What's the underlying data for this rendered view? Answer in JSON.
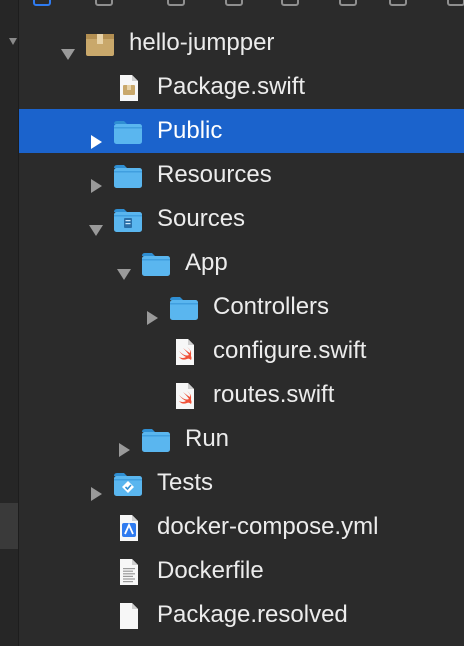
{
  "tree": [
    {
      "label": "hello-jumpper",
      "depth": 0,
      "disclosure": "open",
      "icon": "package-folder-icon",
      "selected": false
    },
    {
      "label": "Package.swift",
      "depth": 1,
      "disclosure": "none",
      "icon": "swift-package-file-icon",
      "selected": false
    },
    {
      "label": "Public",
      "depth": 1,
      "disclosure": "closed",
      "icon": "folder-icon",
      "selected": true
    },
    {
      "label": "Resources",
      "depth": 1,
      "disclosure": "closed",
      "icon": "folder-icon",
      "selected": false
    },
    {
      "label": "Sources",
      "depth": 1,
      "disclosure": "open",
      "icon": "sources-folder-icon",
      "selected": false
    },
    {
      "label": "App",
      "depth": 2,
      "disclosure": "open",
      "icon": "folder-icon",
      "selected": false
    },
    {
      "label": "Controllers",
      "depth": 3,
      "disclosure": "closed",
      "icon": "folder-icon",
      "selected": false
    },
    {
      "label": "configure.swift",
      "depth": 3,
      "disclosure": "none",
      "icon": "swift-file-icon",
      "selected": false
    },
    {
      "label": "routes.swift",
      "depth": 3,
      "disclosure": "none",
      "icon": "swift-file-icon",
      "selected": false
    },
    {
      "label": "Run",
      "depth": 2,
      "disclosure": "closed",
      "icon": "folder-icon",
      "selected": false
    },
    {
      "label": "Tests",
      "depth": 1,
      "disclosure": "closed",
      "icon": "tests-folder-icon",
      "selected": false
    },
    {
      "label": "docker-compose.yml",
      "depth": 1,
      "disclosure": "none",
      "icon": "yaml-file-icon",
      "selected": false
    },
    {
      "label": "Dockerfile",
      "depth": 1,
      "disclosure": "none",
      "icon": "text-file-icon",
      "selected": false
    },
    {
      "label": "Package.resolved",
      "depth": 1,
      "disclosure": "none",
      "icon": "blank-file-icon",
      "selected": false
    }
  ],
  "colors": {
    "selection": "#1b63cc",
    "folder": "#5ab6ef",
    "folder_dark": "#2f8fd3",
    "package": "#c9a86b",
    "swift": "#f05138"
  }
}
